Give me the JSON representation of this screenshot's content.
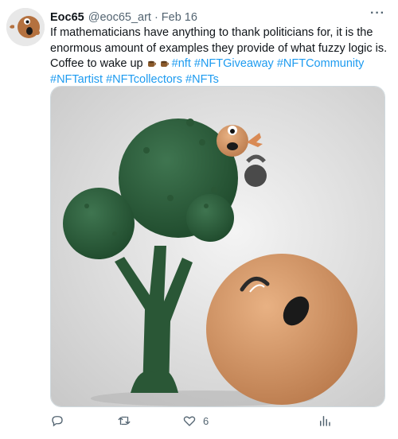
{
  "tweet": {
    "author_name": "Eoc65",
    "handle": "@eoc65_art",
    "separator": "·",
    "date": "Feb 16",
    "more_label": "···",
    "text": "If mathematicians have anything to thank politicians for, it is the enormous amount of examples they provide of what fuzzy logic is. Coffee to wake up ",
    "emoji": [
      "coffee-icon",
      "coffee-icon"
    ],
    "hashtags": [
      "#nft",
      "#NFTGiveaway",
      "#NFTCommunity",
      "#NFTartist",
      "#NFTcollectors",
      "#NFTs"
    ],
    "like_count": "6"
  },
  "colors": {
    "link": "#1d9bf0",
    "text": "#0f1419",
    "muted": "#536471",
    "tree": "#2e5a3a",
    "character": "#d89a6a"
  },
  "icons": {
    "reply": "reply-icon",
    "retweet": "retweet-icon",
    "like": "like-icon",
    "views": "analytics-icon"
  }
}
